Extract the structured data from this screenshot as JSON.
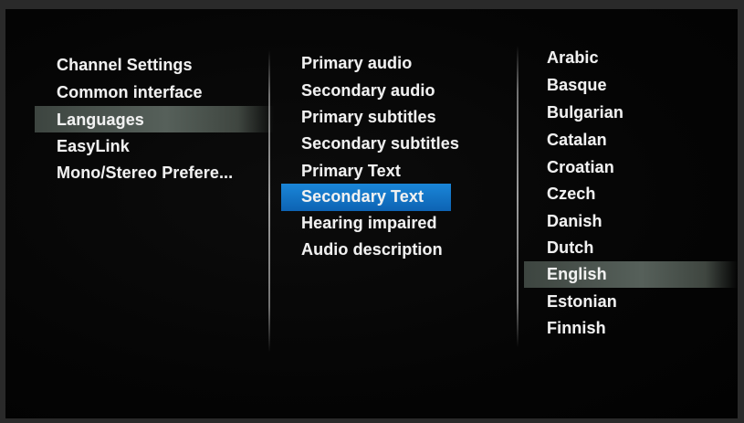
{
  "menu": {
    "column1": {
      "items": [
        "Channel Settings",
        "Common interface",
        "Languages",
        "EasyLink",
        "Mono/Stereo Prefere..."
      ],
      "selected_index": 2
    },
    "column2": {
      "items": [
        "Primary audio",
        "Secondary audio",
        "Primary subtitles",
        "Secondary subtitles",
        "Primary Text",
        "Secondary Text",
        "Hearing impaired",
        "Audio description"
      ],
      "selected_index": 5
    },
    "column3": {
      "items": [
        "Arabic",
        "Basque",
        "Bulgarian",
        "Catalan",
        "Croatian",
        "Czech",
        "Danish",
        "Dutch",
        "English",
        "Estonian",
        "Finnish"
      ],
      "selected_index": 8
    }
  },
  "colors": {
    "focus_highlight": "#1a86d8",
    "path_highlight": "#56605a",
    "text": "#f1f1f1",
    "background": "#050505"
  }
}
